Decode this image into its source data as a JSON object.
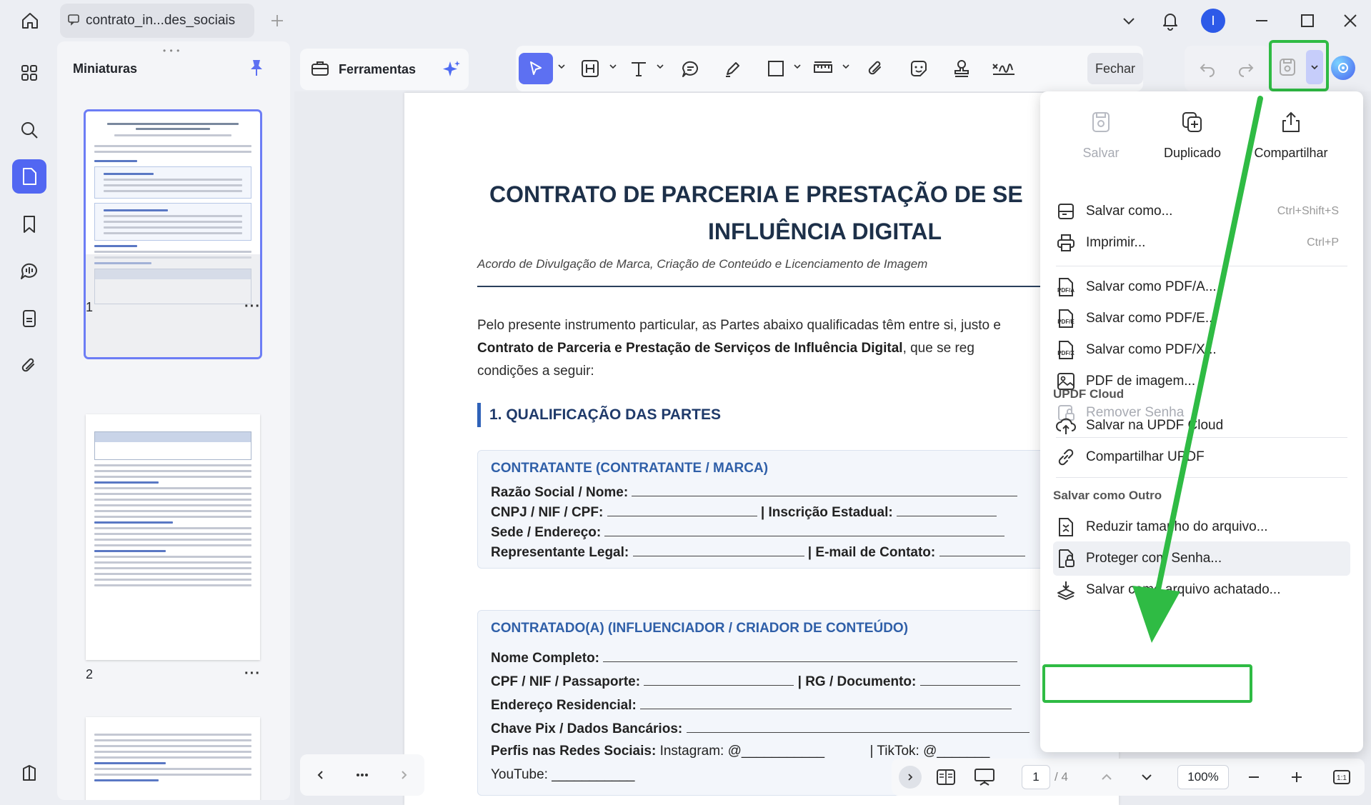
{
  "window": {
    "tab_title": "contrato_in...des_sociais",
    "avatar_letter": "I"
  },
  "thumbnails": {
    "title": "Miniaturas",
    "pages": [
      {
        "number": "1",
        "more": "···"
      },
      {
        "number": "2",
        "more": "···"
      }
    ]
  },
  "toolbar": {
    "tools_label": "Ferramentas",
    "close_label": "Fechar"
  },
  "document": {
    "title_line1": "CONTRATO DE PARCERIA E PRESTAÇÃO DE SE",
    "title_line2": "INFLUÊNCIA DIGITAL",
    "subtitle": "Acordo de Divulgação de Marca, Criação de Conteúdo e Licenciamento de Imagem",
    "para_line1": "Pelo presente instrumento particular, as Partes abaixo qualificadas têm entre si, justo e",
    "para_line2_bold": "Contrato de Parceria e Prestação de Serviços de Influência Digital",
    "para_line2_rest": ", que se reg",
    "para_line3": "condições a seguir:",
    "section1": "1. QUALIFICAÇÃO DAS PARTES",
    "contratante": {
      "heading": "CONTRATANTE (CONTRATANTE / MARCA)",
      "razao": "Razão Social / Nome:",
      "cnpj": "CNPJ / NIF / CPF:",
      "inscricao": "| Inscrição Estadual:",
      "sede": "Sede / Endereço:",
      "representante": "Representante Legal:",
      "email": "| E-mail de Contato:"
    },
    "contratado": {
      "heading": "CONTRATADO(A) (INFLUENCIADOR / CRIADOR DE CONTEÚDO)",
      "nome": "Nome Completo:",
      "cpf": "CPF / NIF / Passaporte:",
      "rg": "| RG / Documento:",
      "endereco": "Endereço Residencial:",
      "pix": "Chave Pix / Dados Bancários:",
      "perfis": "Perfis nas Redes Sociais:",
      "instagram": "Instagram: @___________",
      "tiktok": "| TikTok: @_______",
      "youtube": "YouTube: ___________"
    }
  },
  "bottom": {
    "page_current": "1",
    "page_total": "/ 4",
    "zoom": "100%"
  },
  "menu": {
    "quick": [
      {
        "label": "Salvar",
        "disabled": true
      },
      {
        "label": "Duplicado",
        "disabled": false
      },
      {
        "label": "Compartilhar",
        "disabled": false
      }
    ],
    "save_as": "Salvar como...",
    "save_as_shortcut": "Ctrl+Shift+S",
    "print": "Imprimir...",
    "print_shortcut": "Ctrl+P",
    "pdfa": "Salvar como PDF/A...",
    "pdfe": "Salvar como PDF/E...",
    "pdfx": "Salvar como PDF/X...",
    "pdf_image": "PDF de imagem...",
    "remove_password": "Remover Senha",
    "cloud_group": "UPDF Cloud",
    "save_cloud": "Salvar na UPDF Cloud",
    "share_updf": "Compartilhar UPDF",
    "other_group": "Salvar como Outro",
    "reduce": "Reduzir tamanho do arquivo...",
    "protect": "Proteger com Senha...",
    "flatten": "Salvar como arquivo achatado..."
  },
  "colors": {
    "accent": "#5d70f2",
    "highlight_green": "#2fbb44",
    "doc_heading": "#1d3049",
    "doc_section": "#2f5fa8"
  }
}
